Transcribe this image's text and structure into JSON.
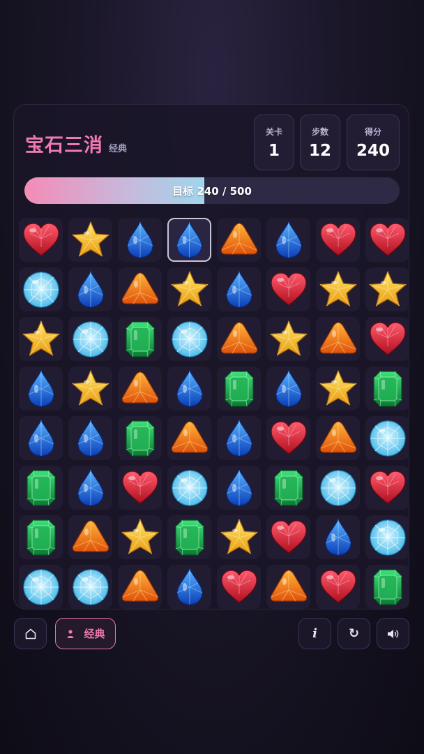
{
  "header": {
    "title": "宝石三消",
    "subtitle": "经典"
  },
  "stats": [
    {
      "label": "关卡",
      "value": "1"
    },
    {
      "label": "步数",
      "value": "12"
    },
    {
      "label": "得分",
      "value": "240"
    }
  ],
  "progress": {
    "text": "目标 240 / 500",
    "score": 240,
    "target": 500
  },
  "board": {
    "selected": {
      "row": 0,
      "col": 3
    },
    "rows": [
      [
        "heart",
        "star",
        "drop",
        "drop",
        "triangle",
        "drop",
        "heart",
        "heart"
      ],
      [
        "diamond",
        "drop",
        "triangle",
        "star",
        "drop",
        "heart",
        "star",
        "star"
      ],
      [
        "star",
        "diamond",
        "emerald",
        "diamond",
        "triangle",
        "star",
        "triangle",
        "heart"
      ],
      [
        "drop",
        "star",
        "triangle",
        "drop",
        "emerald",
        "drop",
        "star",
        "emerald"
      ],
      [
        "drop",
        "drop",
        "emerald",
        "triangle",
        "drop",
        "heart",
        "triangle",
        "diamond"
      ],
      [
        "emerald",
        "drop",
        "heart",
        "diamond",
        "drop",
        "emerald",
        "diamond",
        "heart"
      ],
      [
        "emerald",
        "triangle",
        "star",
        "emerald",
        "star",
        "heart",
        "drop",
        "diamond"
      ],
      [
        "diamond",
        "diamond",
        "triangle",
        "drop",
        "heart",
        "triangle",
        "heart",
        "emerald"
      ]
    ]
  },
  "footer": {
    "home_icon": "home-icon",
    "mode_label": "经典",
    "mode_icon": "person-icon",
    "info_label": "i",
    "refresh_label": "↻",
    "sound_icon": "speaker-icon"
  }
}
